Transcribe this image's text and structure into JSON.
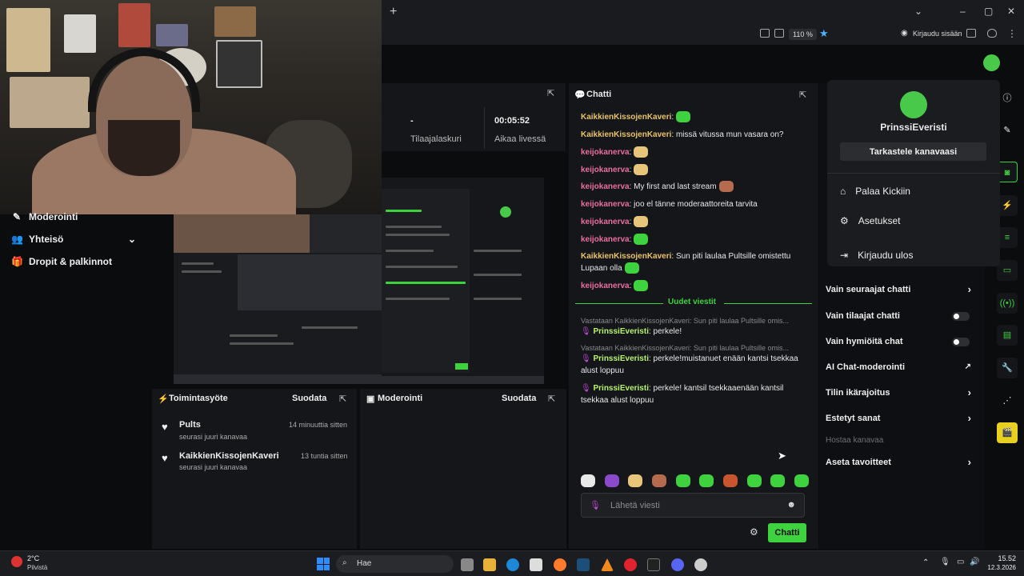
{
  "browser": {
    "zoom": "110 %",
    "signin_label": "Kirjaudu sisään",
    "new_tab": "+"
  },
  "left_nav": {
    "items": [
      {
        "label": "Moderointi",
        "icon": "pin-icon"
      },
      {
        "label": "Yhteisö",
        "icon": "people-icon"
      },
      {
        "label": "Dropit & palkinnot",
        "icon": "gift-icon"
      }
    ]
  },
  "stats": {
    "subs_value": "-",
    "subs_label": "Tilaajalaskuri",
    "live_value": "00:05:52",
    "live_label": "Aikaa livessä"
  },
  "activity": {
    "title": "Toimintasyöte",
    "filter": "Suodata",
    "items": [
      {
        "name": "Pults",
        "sub": "seurasi juuri kanavaa",
        "time": "14 minuuttia sitten"
      },
      {
        "name": "KaikkienKissojenKaveri",
        "sub": "seurasi juuri kanavaa",
        "time": "13 tuntia sitten"
      }
    ]
  },
  "moderation": {
    "title": "Moderointi",
    "filter": "Suodata"
  },
  "chat": {
    "title": "Chatti",
    "messages": [
      {
        "user": "KaikkienKissojenKaveri",
        "text": ":",
        "color": "u-green"
      },
      {
        "user": "KaikkienKissojenKaveri",
        "text": ": missä vitussa mun vasara on?",
        "color": "u-green"
      },
      {
        "user": "keijokanerva",
        "text": ":",
        "color": "u-pink"
      },
      {
        "user": "keijokanerva",
        "text": ":",
        "color": "u-pink"
      },
      {
        "user": "keijokanerva",
        "text": ": My first and last stream",
        "color": "u-pink"
      },
      {
        "user": "keijokanerva",
        "text": ": joo el tänne moderaattoreita tarvita",
        "color": "u-pink"
      },
      {
        "user": "keijokanerva",
        "text": ":",
        "color": "u-pink"
      },
      {
        "user": "keijokanerva",
        "text": ":",
        "color": "u-pink"
      },
      {
        "user": "KaikkienKissojenKaveri",
        "text": ": Sun piti laulaa Pultsille omistettu Lupaan olla",
        "color": "u-green"
      },
      {
        "user": "keijokanerva",
        "text": ":",
        "color": "u-pink"
      }
    ],
    "new_messages_label": "Uudet viestit",
    "replies": [
      {
        "reply_to": "Vastataan KaikkienKissojenKaveri: Sun piti laulaa Pultsille omis...",
        "user": "PrinssiEveristi",
        "text": ": perkele!"
      },
      {
        "reply_to": "Vastataan KaikkienKissojenKaveri: Sun piti laulaa Pultsille omis...",
        "user": "PrinssiEveristi",
        "text": ": perkele!muistanuet enään kantsi tsekkaa alust loppuu"
      },
      {
        "reply_to": "",
        "user": "PrinssiEveristi",
        "text": ": perkele! kantsil tsekkaaenään kantsil tsekkaa alust loppuu"
      }
    ],
    "input_placeholder": "Lähetä viesti",
    "send_label": "Chatti"
  },
  "settings": {
    "rows": [
      {
        "label": "Vain seuraajat chatti",
        "control": "chevron"
      },
      {
        "label": "Vain tilaajat chatti",
        "control": "toggle"
      },
      {
        "label": "Vain hymiöitä chat",
        "control": "toggle"
      },
      {
        "label": "AI Chat-moderointi",
        "control": "external"
      },
      {
        "label": "Tilin ikärajoitus",
        "control": "chevron"
      },
      {
        "label": "Estetyt sanat",
        "control": "chevron"
      },
      {
        "label": "Hostaa kanavaa",
        "control": "none"
      },
      {
        "label": "Aseta tavoitteet",
        "control": "chevron"
      }
    ]
  },
  "user_menu": {
    "name": "PrinssiEveristi",
    "view_channel": "Tarkastele kanavaasi",
    "items": [
      {
        "label": "Palaa Kickiin",
        "icon": "home-icon"
      },
      {
        "label": "Asetukset",
        "icon": "gear-icon"
      },
      {
        "label": "Kirjaudu ulos",
        "icon": "logout-icon"
      }
    ]
  },
  "taskbar": {
    "weather_temp": "2°C",
    "weather_desc": "Pilvistä",
    "search": "Hae",
    "time": "15.52",
    "date": "12.3.2026"
  },
  "colors": {
    "accent_green": "#3fd23f",
    "panel_bg": "#15161a",
    "page_bg": "#0b0c0e"
  }
}
